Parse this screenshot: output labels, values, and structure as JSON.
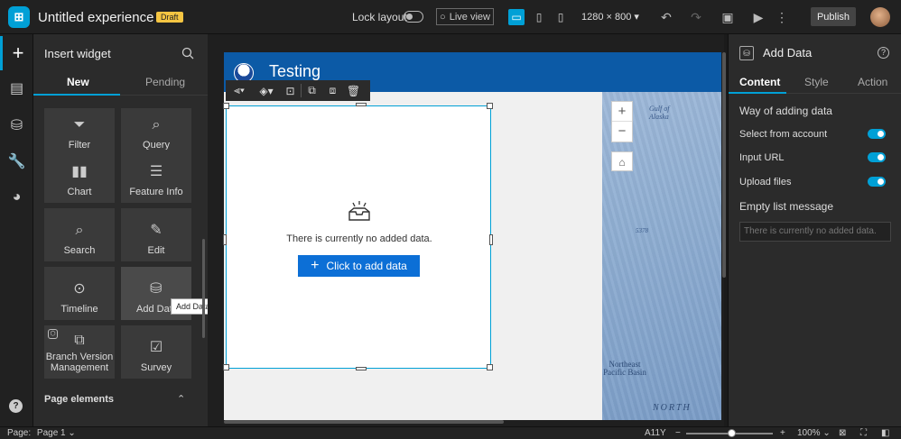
{
  "app": {
    "title": "Untitled experience 1",
    "draft_badge": "Draft",
    "lock_layout_label": "Lock layout",
    "live_view_label": "Live view",
    "resolution": "1280 × 800",
    "publish_label": "Publish",
    "accent": "#00a0d6"
  },
  "left_panel": {
    "title": "Insert widget",
    "tabs": [
      {
        "label": "New"
      },
      {
        "label": "Pending"
      }
    ],
    "widgets": [
      {
        "label": "Filter",
        "icon": "filter-icon"
      },
      {
        "label": "Query",
        "icon": "query-icon"
      },
      {
        "label": "Chart",
        "icon": "chart-icon"
      },
      {
        "label": "Feature Info",
        "icon": "feature-info-icon"
      },
      {
        "label": "Search",
        "icon": "search-icon"
      },
      {
        "label": "Edit",
        "icon": "edit-icon"
      },
      {
        "label": "Timeline",
        "icon": "timeline-icon"
      },
      {
        "label": "Add Data",
        "icon": "add-data-icon"
      },
      {
        "label": "Branch Version Management",
        "icon": "branch-version-icon"
      },
      {
        "label": "Survey",
        "icon": "survey-icon"
      }
    ],
    "tooltip": "Add Data",
    "section": "Page elements"
  },
  "canvas": {
    "page_title": "Testing",
    "empty_text": "There is currently no added data.",
    "add_button_label": "Click to add data",
    "map_labels": {
      "gulf": "Gulf of Alaska",
      "depth": "5378",
      "basin": "Northeast Pacific Basin",
      "north": "NORTH"
    }
  },
  "right_panel": {
    "title": "Add Data",
    "tabs": [
      {
        "label": "Content"
      },
      {
        "label": "Style"
      },
      {
        "label": "Action"
      }
    ],
    "section1": "Way of adding data",
    "options": [
      {
        "label": "Select from account",
        "enabled": true
      },
      {
        "label": "Input URL",
        "enabled": true
      },
      {
        "label": "Upload files",
        "enabled": true
      }
    ],
    "section2": "Empty list message",
    "empty_message_placeholder": "There is currently no added data."
  },
  "bottom": {
    "page_label": "Page:",
    "page_value": "Page 1",
    "a11y": "A11Y",
    "zoom": "100%"
  }
}
